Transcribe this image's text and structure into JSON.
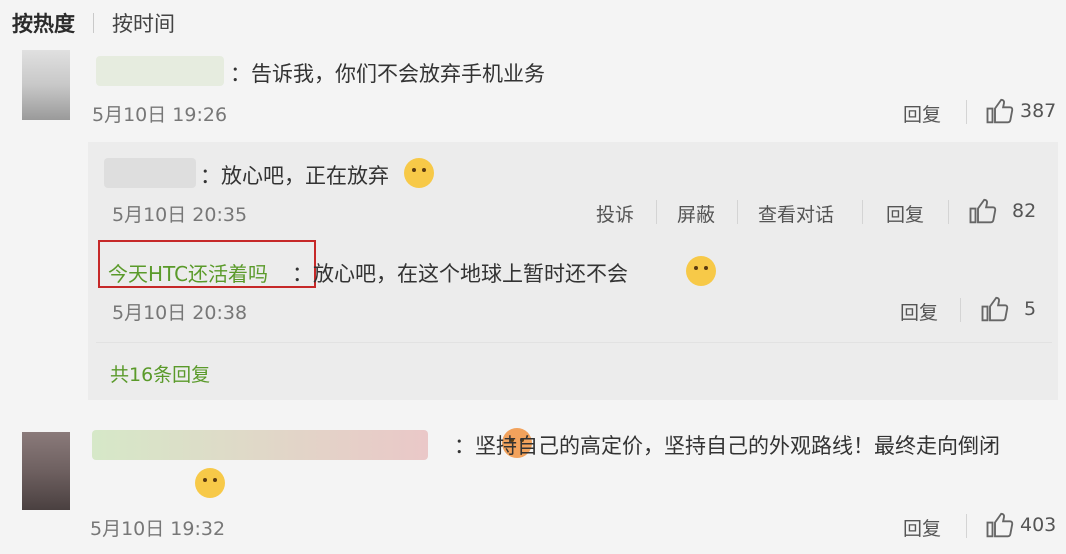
{
  "tabs": {
    "hot": "按热度",
    "time": "按时间"
  },
  "comments": [
    {
      "text": "：告诉我，你们不会放弃手机业务",
      "time": "5月10日 19:26",
      "reply_label": "回复",
      "likes": "387"
    },
    {
      "text": "：坚持自己的高定价，坚持自己的外观路线！最终走向倒闭",
      "time": "5月10日 19:32",
      "reply_label": "回复",
      "likes": "403"
    }
  ],
  "replies": [
    {
      "text": "：放心吧，正在放弃",
      "time": "5月10日 20:35",
      "report_label": "投诉",
      "block_label": "屏蔽",
      "view_label": "查看对话",
      "reply_label": "回复",
      "likes": "82"
    },
    {
      "user": "今天HTC还活着吗",
      "text": "：放心吧，在这个地球上暂时还不会",
      "time": "5月10日 20:38",
      "reply_label": "回复",
      "likes": "5"
    }
  ],
  "more_replies": "共16条回复",
  "colors": {
    "accent_green": "#5a9a2a",
    "highlight_border": "#c62828"
  },
  "icons": [
    "thumbs-up-icon",
    "emoji-icon"
  ]
}
